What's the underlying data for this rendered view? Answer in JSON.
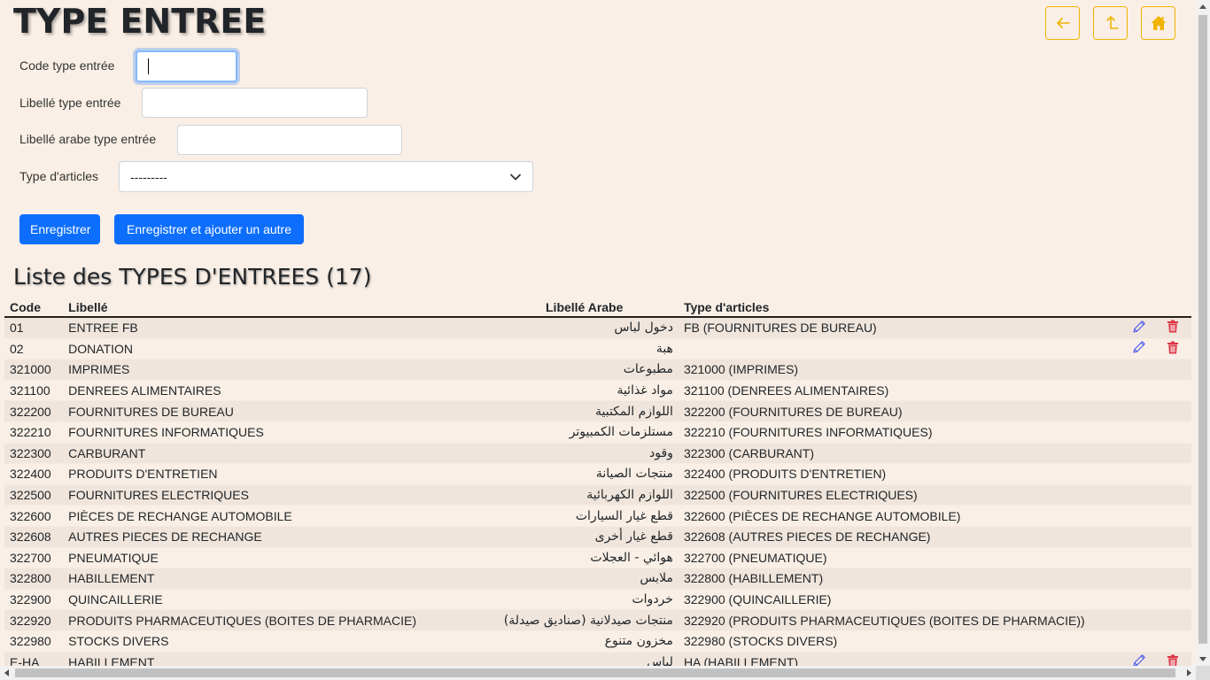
{
  "header": {
    "title": "TYPE ENTREE"
  },
  "nav_buttons": [
    "back-arrow-icon",
    "up-arrow-icon",
    "home-icon"
  ],
  "colors": {
    "accent_border": "#f0b400",
    "primary": "#0d6efd",
    "delete": "#dc3545",
    "edit": "#4b5cf0",
    "background": "#f9efe6"
  },
  "form": {
    "code_label": "Code type entrée",
    "code_value": "",
    "libelle_label": "Libellé type entrée",
    "libelle_value": "",
    "libelle_arabe_label": "Libellé arabe type entrée",
    "libelle_arabe_value": "",
    "type_articles_label": "Type d'articles",
    "type_articles_selected": "---------",
    "save_label": "Enregistrer",
    "save_add_label": "Enregistrer et ajouter un autre"
  },
  "list": {
    "title": "Liste des TYPES D'ENTREES (17)",
    "columns": [
      "Code",
      "Libellé",
      "Libellé Arabe",
      "Type d'articles"
    ],
    "rows": [
      {
        "code": "01",
        "libelle": "ENTREE FB",
        "arabe": "دخول لباس",
        "type": "FB (FOURNITURES DE BUREAU)",
        "actions": true
      },
      {
        "code": "02",
        "libelle": "DONATION",
        "arabe": "هبة",
        "type": "",
        "actions": true
      },
      {
        "code": "321000",
        "libelle": "IMPRIMES",
        "arabe": "مطبوعات",
        "type": "321000 (IMPRIMES)",
        "actions": false
      },
      {
        "code": "321100",
        "libelle": "DENREES ALIMENTAIRES",
        "arabe": "مواد غذائية",
        "type": "321100 (DENREES ALIMENTAIRES)",
        "actions": false
      },
      {
        "code": "322200",
        "libelle": "FOURNITURES DE BUREAU",
        "arabe": "اللوازم المكتبية",
        "type": "322200 (FOURNITURES DE BUREAU)",
        "actions": false
      },
      {
        "code": "322210",
        "libelle": "FOURNITURES INFORMATIQUES",
        "arabe": "مستلزمات الكمبيوتر",
        "type": "322210 (FOURNITURES INFORMATIQUES)",
        "actions": false
      },
      {
        "code": "322300",
        "libelle": "CARBURANT",
        "arabe": "وقود",
        "type": "322300 (CARBURANT)",
        "actions": false
      },
      {
        "code": "322400",
        "libelle": "PRODUITS D'ENTRETIEN",
        "arabe": "منتجات الصيانة",
        "type": "322400 (PRODUITS D'ENTRETIEN)",
        "actions": false
      },
      {
        "code": "322500",
        "libelle": "FOURNITURES ELECTRIQUES",
        "arabe": "اللوازم الكهربائية",
        "type": "322500 (FOURNITURES ELECTRIQUES)",
        "actions": false
      },
      {
        "code": "322600",
        "libelle": "PIÈCES DE RECHANGE AUTOMOBILE",
        "arabe": "قطع غيار السيارات",
        "type": "322600 (PIÈCES DE RECHANGE AUTOMOBILE)",
        "actions": false
      },
      {
        "code": "322608",
        "libelle": "AUTRES PIECES DE RECHANGE",
        "arabe": "قطع غيار أخرى",
        "type": "322608 (AUTRES PIECES DE RECHANGE)",
        "actions": false
      },
      {
        "code": "322700",
        "libelle": "PNEUMATIQUE",
        "arabe": "هوائي - العجلات",
        "type": "322700 (PNEUMATIQUE)",
        "actions": false
      },
      {
        "code": "322800",
        "libelle": "HABILLEMENT",
        "arabe": "ملابس",
        "type": "322800 (HABILLEMENT)",
        "actions": false
      },
      {
        "code": "322900",
        "libelle": "QUINCAILLERIE",
        "arabe": "خردوات",
        "type": "322900 (QUINCAILLERIE)",
        "actions": false
      },
      {
        "code": "322920",
        "libelle": "PRODUITS PHARMACEUTIQUES (BOITES DE PHARMACIE)",
        "arabe": "منتجات صيدلانية (صناديق صيدلة)",
        "type": "322920 (PRODUITS PHARMACEUTIQUES (BOITES DE PHARMACIE))",
        "actions": false
      },
      {
        "code": "322980",
        "libelle": "STOCKS DIVERS",
        "arabe": "مخزون متنوع",
        "type": "322980 (STOCKS DIVERS)",
        "actions": false
      },
      {
        "code": "E-HA",
        "libelle": "HABILLEMENT",
        "arabe": "لباس",
        "type": "HA (HABILLEMENT)",
        "actions": true
      }
    ]
  }
}
